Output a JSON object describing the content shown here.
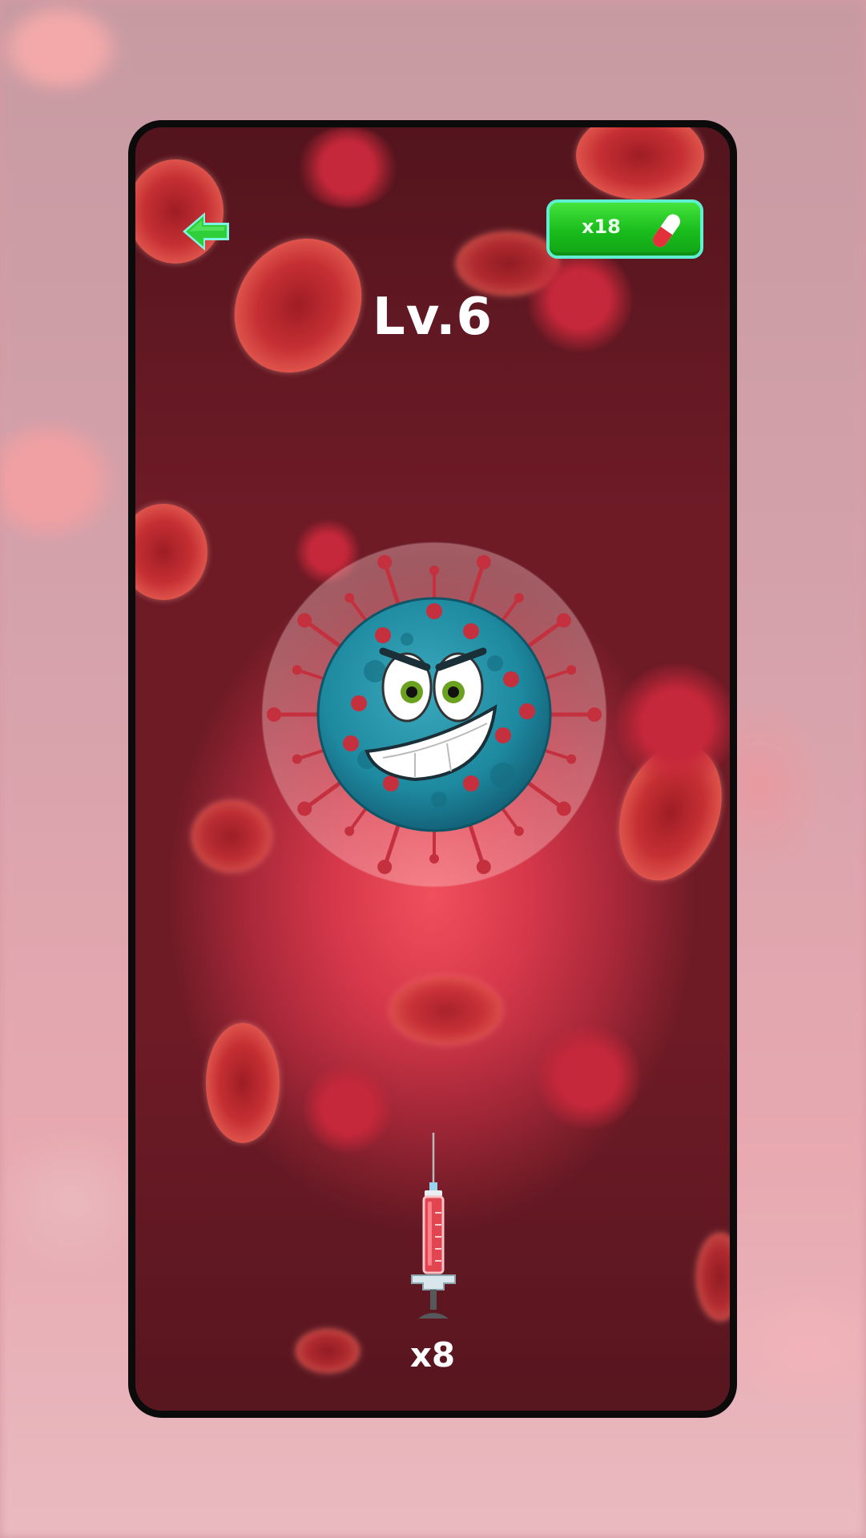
{
  "hud": {
    "level_label": "Lv.6",
    "pill_count": "x18",
    "syringe_count": "x8"
  },
  "icons": {
    "back": "back-arrow-icon",
    "pill": "pill-icon",
    "syringe": "syringe-icon",
    "virus": "virus-enemy"
  },
  "colors": {
    "accent_green": "#19bc1c",
    "pill_border": "#5ff0d2",
    "virus_body": "#1e8aa0",
    "virus_spikes": "#c4303e"
  }
}
